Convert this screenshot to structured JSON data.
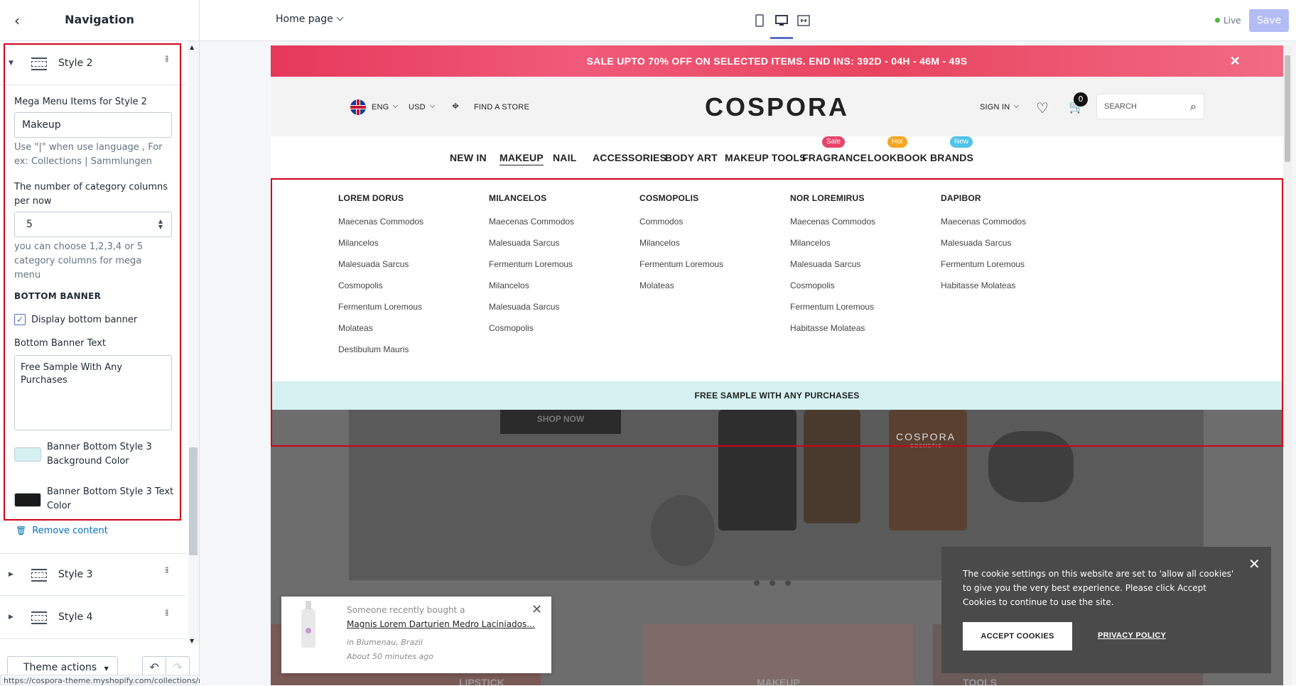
{
  "topbar": {
    "back_icon": "chevron-left-icon",
    "sidebar_title": "Navigation",
    "page_selector": "Home page",
    "device_icons": [
      "mobile-icon",
      "desktop-icon",
      "fullscreen-icon"
    ],
    "live_label": "Live",
    "save_label": "Save"
  },
  "sidebar": {
    "active_block": {
      "label": "Style 2",
      "mega_items_label": "Mega Menu Items for Style 2",
      "mega_items_value": "Makeup",
      "mega_items_help": "Use \"|\" when use language , For ex: Collections | Sammlungen",
      "columns_label": "The number of category columns per now",
      "columns_value": "5",
      "columns_help": "you can choose 1,2,3,4 or 5 category columns for mega menu",
      "bottom_banner_heading": "BOTTOM BANNER",
      "display_bottom_banner_label": "Display bottom banner",
      "display_bottom_banner_checked": true,
      "bottom_banner_text_label": "Bottom Banner Text",
      "bottom_banner_text_value": "Free Sample With Any Purchases",
      "bg_color_label": "Banner Bottom Style 3 Background Color",
      "bg_color": "#d5f1f1",
      "text_color_label": "Banner Bottom Style 3 Text Color",
      "text_color": "#1a1a1a"
    },
    "remove_label": "Remove content",
    "other_blocks": [
      {
        "label": "Style 3"
      },
      {
        "label": "Style 4"
      }
    ],
    "theme_actions_label": "Theme actions",
    "status_url": "https://cospora-theme.myshopify.com/collections/makeup"
  },
  "preview": {
    "promo_text": "SALE UPTO 70% OFF ON SELECTED ITEMS. END INS: 392D - 04H - 46M - 49S",
    "header": {
      "language": "ENG",
      "currency": "USD",
      "find_store": "FIND A STORE",
      "logo": "COSPORA",
      "sign_in": "SIGN IN",
      "cart_count": "0",
      "search_placeholder": "SEARCH"
    },
    "nav": [
      {
        "label": "NEW IN",
        "badge": ""
      },
      {
        "label": "MAKEUP",
        "badge": ""
      },
      {
        "label": "NAIL",
        "badge": ""
      },
      {
        "label": "ACCESSORIES",
        "badge": ""
      },
      {
        "label": "BODY ART",
        "badge": ""
      },
      {
        "label": "MAKEUP TOOLS",
        "badge": ""
      },
      {
        "label": "FRAGRANCE",
        "badge": "Sale"
      },
      {
        "label": "LOOKBOOK",
        "badge": "Hot"
      },
      {
        "label": "BRANDS",
        "badge": "New"
      }
    ],
    "badge_colors": {
      "Sale": "#e8436a",
      "Hot": "#f5a623",
      "New": "#4fc3e8"
    },
    "mega_columns": [
      {
        "heading": "LOREM DORUS",
        "links": [
          "Maecenas Commodos",
          "Milancelos",
          "Malesuada Sarcus",
          "Cosmopolis",
          "Fermentum Loremous",
          "Molateas",
          "Destibulum Mauris"
        ]
      },
      {
        "heading": "MILANCELOS",
        "links": [
          "Maecenas Commodos",
          "Malesuada Sarcus",
          "Fermentum Loremous",
          "Milancelos",
          "Malesuada Sarcus",
          "Cosmopolis"
        ]
      },
      {
        "heading": "COSMOPOLIS",
        "links": [
          "Commodos",
          "Milancelos",
          "Fermentum Loremous",
          "Molateas"
        ]
      },
      {
        "heading": "NOR LOREMIRUS",
        "links": [
          "Maecenas Commodos",
          "Milancelos",
          "Malesuada Sarcus",
          "Cosmopolis",
          "Fermentum Loremous",
          "Habitasse Molateas"
        ]
      },
      {
        "heading": "DAPIBOR",
        "links": [
          "Maecenas Commodos",
          "Malesuada Sarcus",
          "Fermentum Loremous",
          "Habitasse Molateas"
        ]
      }
    ],
    "mega_banner": "FREE SAMPLE WITH ANY PURCHASES",
    "hero": {
      "shop_now": "SHOP NOW",
      "bottle_brand": "COSPORA",
      "bottle_sub": "COSMETIC",
      "tiles": [
        "LIPSTICK",
        "MAKEUP",
        "TOOLS"
      ]
    },
    "toast": {
      "line1": "Someone recently bought a",
      "product": "Magnis Lorem Darturien Medro Laciniados...",
      "location": "in Blumenau, Brazil",
      "time": "About 50 minutes ago"
    },
    "cookie": {
      "text": "The cookie settings on this website are set to 'allow all cookies' to give you the very best experience. Please click Accept Cookies to continue to use the site.",
      "accept": "ACCEPT COOKIES",
      "privacy": "PRIVACY POLICY"
    }
  }
}
